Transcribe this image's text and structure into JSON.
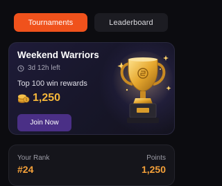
{
  "tabs": [
    {
      "label": "Tournaments",
      "active": true
    },
    {
      "label": "Leaderboard",
      "active": false
    }
  ],
  "tournament": {
    "title": "Weekend Warriors",
    "time_left": "3d 12h left",
    "reward_text": "Top 100 win rewards",
    "reward_amount": "1,250",
    "join_label": "Join Now",
    "icons": [
      "clock-icon",
      "coin-stack-icon",
      "trophy-icon"
    ]
  },
  "stats": {
    "rank_label": "Your Rank",
    "rank_value": "#24",
    "points_label": "Points",
    "points_value": "1,250"
  },
  "colors": {
    "accent": "#f0521c",
    "gold": "#f5b73a",
    "button": "#4a2f86",
    "background": "#0c0c10"
  }
}
